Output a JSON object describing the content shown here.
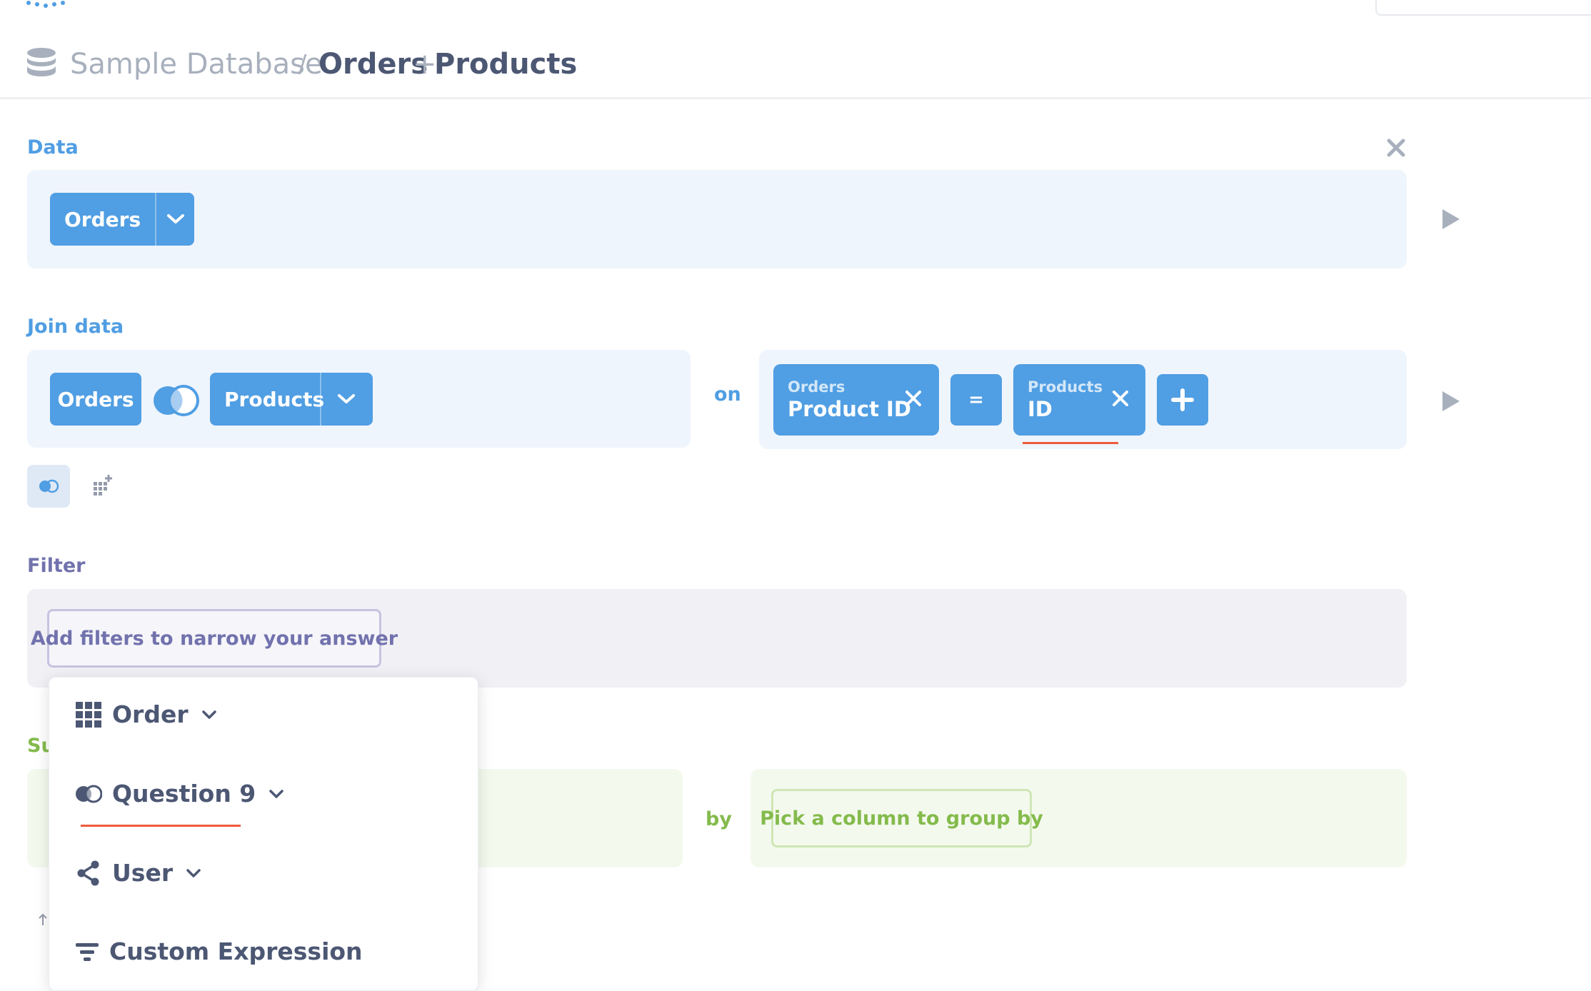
{
  "header": {
    "breadcrumb": {
      "database": "Sample Database",
      "separator": "/",
      "table_primary": "Orders",
      "join_symbol": "+",
      "table_secondary": "Products"
    }
  },
  "data_section": {
    "label": "Data",
    "source_table": "Orders",
    "close_icon": "close-icon"
  },
  "join_section": {
    "label": "Join data",
    "left_table": "Orders",
    "join_type_icon": "left-join-icon",
    "right_table": "Products",
    "on_label": "on",
    "left_condition": {
      "table": "Orders",
      "column": "Product ID"
    },
    "operator": "=",
    "right_condition": {
      "table": "Products",
      "column": "ID"
    }
  },
  "step_icons": [
    "join-icon",
    "custom-column-icon"
  ],
  "filter_section": {
    "label": "Filter",
    "button_label": "Add filters to narrow your answer"
  },
  "summarize_section": {
    "label_visible": "Su",
    "by_label": "by",
    "group_button_label": "Pick a column to group by"
  },
  "popover": {
    "items": [
      {
        "label": "Order",
        "icon": "table-icon"
      },
      {
        "label": "Question 9",
        "icon": "join-icon"
      },
      {
        "label": "User",
        "icon": "connections-icon"
      },
      {
        "label": "Custom Expression",
        "icon": "filter-icon"
      }
    ]
  },
  "colors": {
    "brand_blue": "#509ee3",
    "filter_purple": "#7172ad",
    "summarize_green": "#84bb4c",
    "text_dark": "#4c5773",
    "highlight_red": "#ef5a3d"
  }
}
